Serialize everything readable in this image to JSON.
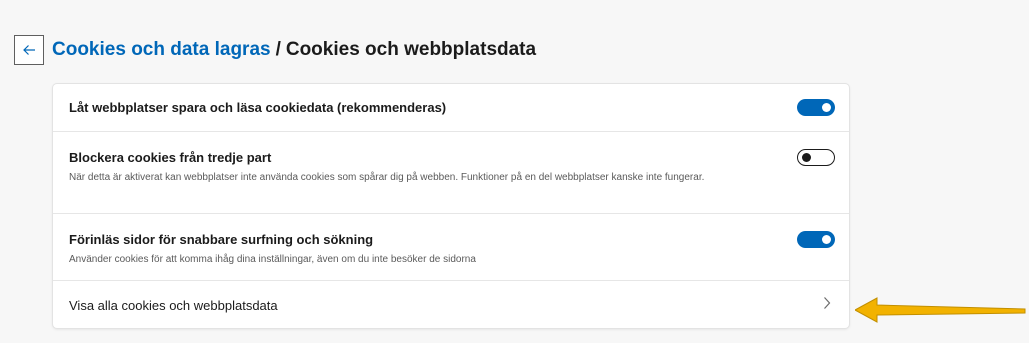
{
  "header": {
    "back_icon": "arrow-left-icon",
    "breadcrumb_parent": "Cookies och data lagras",
    "separator": "/",
    "breadcrumb_current": "Cookies och webbplatsdata"
  },
  "settings": {
    "allow_cookies": {
      "title": "Låt webbplatser spara och läsa cookiedata (rekommenderas)",
      "enabled": true
    },
    "block_third_party": {
      "title": "Blockera cookies från tredje part",
      "description": "När detta är aktiverat kan webbplatser inte använda cookies som spårar dig på webben. Funktioner på en del webbplatser kanske inte fungerar.",
      "enabled": false
    },
    "preload_pages": {
      "title": "Förinläs sidor för snabbare surfning och sökning",
      "description": "Använder cookies för att komma ihåg dina inställningar, även om du inte besöker de sidorna",
      "enabled": true
    },
    "see_all": {
      "title": "Visa alla cookies och webbplatsdata",
      "icon": "chevron-right-icon"
    }
  },
  "annotation": {
    "icon": "arrow-left-icon",
    "color": "#f2b200"
  },
  "colors": {
    "accent": "#0067b8",
    "toggle_off_border": "#1b1b1b",
    "page_background": "#f7f7f7"
  }
}
